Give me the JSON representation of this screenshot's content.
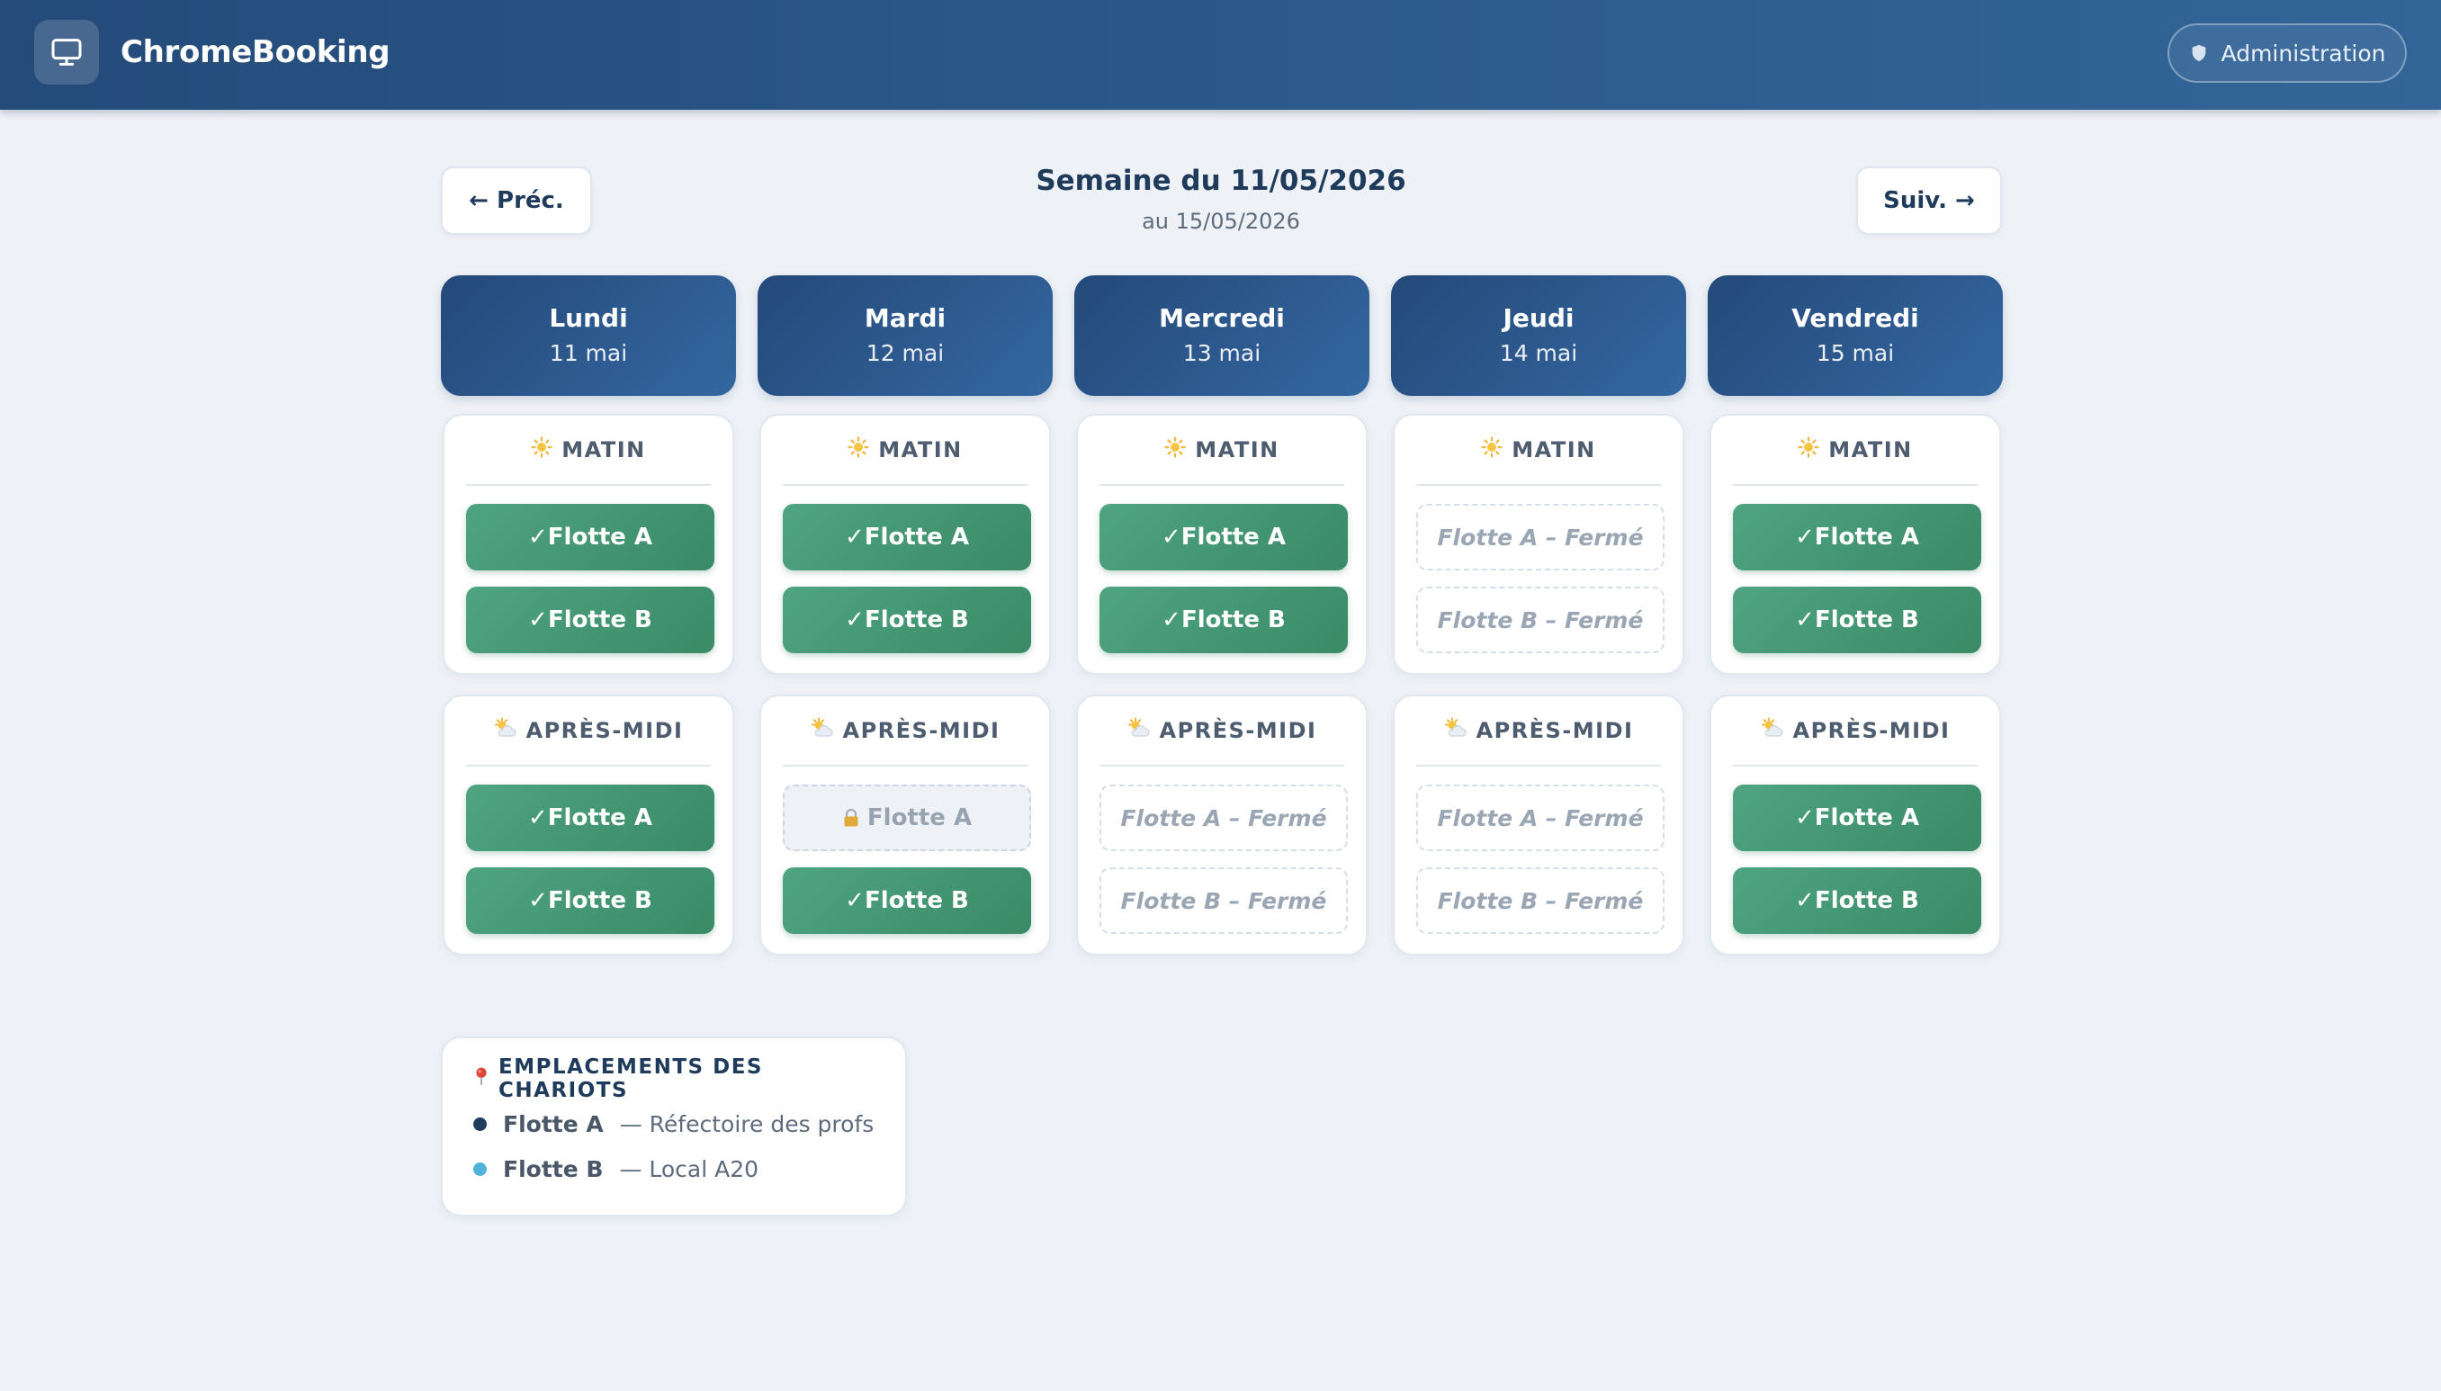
{
  "app": {
    "title": "ChromeBooking",
    "admin_label": "Administration"
  },
  "week": {
    "prev_label": "← Préc.",
    "next_label": "Suiv. →",
    "title": "Semaine du 11/05/2026",
    "subtitle": "au 15/05/2026"
  },
  "days": [
    {
      "name": "Lundi",
      "date": "11 mai",
      "morning": {
        "label": "MATIN",
        "fleets": [
          {
            "label": "✓Flotte A",
            "state": "available"
          },
          {
            "label": "✓Flotte B",
            "state": "available"
          }
        ]
      },
      "afternoon": {
        "label": "APRÈS-MIDI",
        "fleets": [
          {
            "label": "✓Flotte A",
            "state": "available"
          },
          {
            "label": "✓Flotte B",
            "state": "available"
          }
        ]
      }
    },
    {
      "name": "Mardi",
      "date": "12 mai",
      "morning": {
        "label": "MATIN",
        "fleets": [
          {
            "label": "✓Flotte A",
            "state": "available"
          },
          {
            "label": "✓Flotte B",
            "state": "available"
          }
        ]
      },
      "afternoon": {
        "label": "APRÈS-MIDI",
        "fleets": [
          {
            "label": "Flotte A",
            "state": "locked"
          },
          {
            "label": "✓Flotte B",
            "state": "available"
          }
        ]
      }
    },
    {
      "name": "Mercredi",
      "date": "13 mai",
      "morning": {
        "label": "MATIN",
        "fleets": [
          {
            "label": "✓Flotte A",
            "state": "available"
          },
          {
            "label": "✓Flotte B",
            "state": "available"
          }
        ]
      },
      "afternoon": {
        "label": "APRÈS-MIDI",
        "fleets": [
          {
            "label": "Flotte A – Fermé",
            "state": "closed"
          },
          {
            "label": "Flotte B – Fermé",
            "state": "closed"
          }
        ]
      }
    },
    {
      "name": "Jeudi",
      "date": "14 mai",
      "morning": {
        "label": "MATIN",
        "fleets": [
          {
            "label": "Flotte A – Fermé",
            "state": "closed"
          },
          {
            "label": "Flotte B – Fermé",
            "state": "closed"
          }
        ]
      },
      "afternoon": {
        "label": "APRÈS-MIDI",
        "fleets": [
          {
            "label": "Flotte A – Fermé",
            "state": "closed"
          },
          {
            "label": "Flotte B – Fermé",
            "state": "closed"
          }
        ]
      }
    },
    {
      "name": "Vendredi",
      "date": "15 mai",
      "morning": {
        "label": "MATIN",
        "fleets": [
          {
            "label": "✓Flotte A",
            "state": "available"
          },
          {
            "label": "✓Flotte B",
            "state": "available"
          }
        ]
      },
      "afternoon": {
        "label": "APRÈS-MIDI",
        "fleets": [
          {
            "label": "✓Flotte A",
            "state": "available"
          },
          {
            "label": "✓Flotte B",
            "state": "available"
          }
        ]
      }
    }
  ],
  "locations": {
    "title": "EMPLACEMENTS DES CHARIOTS",
    "items": [
      {
        "fleet": "Flotte A",
        "place": "— Réfectoire des profs",
        "color": "#1f3b5c"
      },
      {
        "fleet": "Flotte B",
        "place": "— Local A20",
        "color": "#4fb3d9"
      }
    ]
  },
  "colors": {
    "header": "#2c5a8d",
    "available": "#439673",
    "background": "#eef2f7"
  }
}
